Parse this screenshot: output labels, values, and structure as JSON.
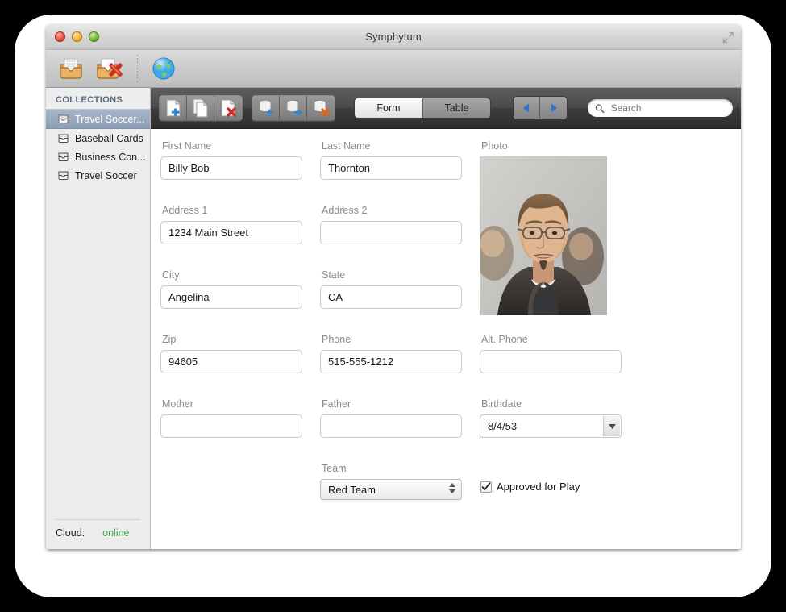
{
  "window": {
    "title": "Symphytum",
    "traffic_lights": [
      "close-button",
      "minimize-button",
      "zoom-button"
    ]
  },
  "app_toolbar": {
    "items": [
      {
        "name": "new-collection-icon",
        "label": "New Collection"
      },
      {
        "name": "delete-collection-icon",
        "label": "Delete Collection"
      },
      {
        "name": "cloud-globe-icon",
        "label": "Cloud Sync"
      }
    ]
  },
  "sidebar": {
    "header": "COLLECTIONS",
    "items": [
      {
        "label": "Travel Soccer...",
        "selected": true
      },
      {
        "label": "Baseball Cards",
        "selected": false
      },
      {
        "label": "Business Con...",
        "selected": false
      },
      {
        "label": "Travel Soccer",
        "selected": false
      }
    ],
    "cloud_label": "Cloud:",
    "cloud_status": "online",
    "cloud_status_color": "#3fa63f"
  },
  "record_toolbar": {
    "record_buttons": [
      {
        "name": "add-record-button",
        "label": "Add Record"
      },
      {
        "name": "duplicate-record-button",
        "label": "Duplicate Record"
      },
      {
        "name": "delete-record-button",
        "label": "Delete Record"
      }
    ],
    "collection_buttons": [
      {
        "name": "add-collection-button",
        "label": "Add Collection"
      },
      {
        "name": "export-collection-button",
        "label": "Export Collection"
      },
      {
        "name": "delete-collection-button",
        "label": "Delete Collection"
      }
    ],
    "view_modes": [
      {
        "label": "Form",
        "selected": true
      },
      {
        "label": "Table",
        "selected": false
      }
    ],
    "nav": [
      {
        "name": "previous-record-button",
        "label": "Previous"
      },
      {
        "name": "next-record-button",
        "label": "Next"
      }
    ],
    "search": {
      "placeholder": "Search",
      "value": ""
    }
  },
  "form": {
    "fields": {
      "first_name": {
        "label": "First Name",
        "value": "Billy Bob"
      },
      "last_name": {
        "label": "Last Name",
        "value": "Thornton"
      },
      "photo": {
        "label": "Photo"
      },
      "address1": {
        "label": "Address 1",
        "value": "1234 Main Street"
      },
      "address2": {
        "label": "Address 2",
        "value": ""
      },
      "city": {
        "label": "City",
        "value": "Angelina"
      },
      "state": {
        "label": "State",
        "value": "CA"
      },
      "zip": {
        "label": "Zip",
        "value": "94605"
      },
      "phone": {
        "label": "Phone",
        "value": "515-555-1212"
      },
      "alt_phone": {
        "label": "Alt. Phone",
        "value": ""
      },
      "mother": {
        "label": "Mother",
        "value": ""
      },
      "father": {
        "label": "Father",
        "value": ""
      },
      "birthdate": {
        "label": "Birthdate",
        "value": "8/4/53"
      },
      "team": {
        "label": "Team",
        "value": "Red Team"
      },
      "approved": {
        "label": "Approved for Play",
        "checked": true
      }
    }
  }
}
